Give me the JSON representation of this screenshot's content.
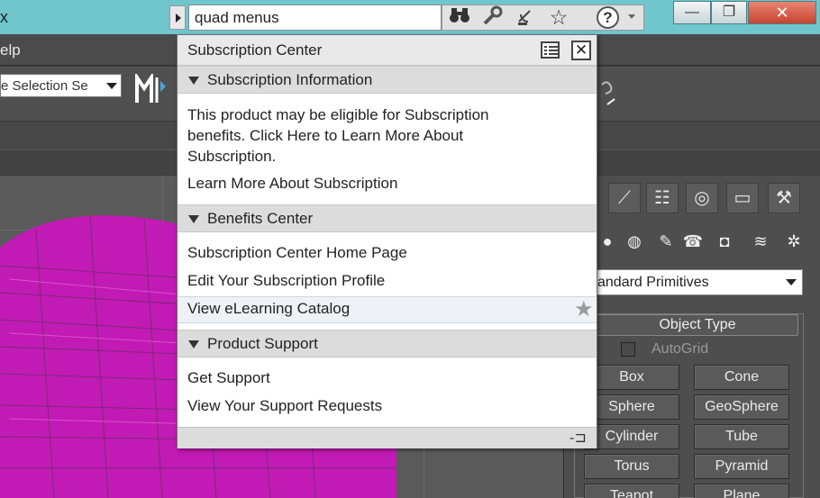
{
  "titlebar": {
    "partial_text": "x",
    "search_value": "quad menus",
    "tool_icons": [
      "binoculars-icon",
      "wrench-icon",
      "satellite-icon",
      "favorites-star-icon"
    ],
    "help_label": "?",
    "minimize": "—",
    "restore": "❐",
    "close": "✕"
  },
  "menubar": {
    "partial_text": "elp"
  },
  "toolbar": {
    "selection_set_value": "e Selection Se"
  },
  "subscription_center": {
    "title": "Subscription Center",
    "sections": [
      {
        "heading": "Subscription Information",
        "items": [
          "This product may be eligible for Subscription",
          "benefits. Click Here to Learn More About",
          "Subscription.",
          "Learn More About Subscription"
        ]
      },
      {
        "heading": "Benefits Center",
        "items": [
          "Subscription Center Home Page",
          "Edit Your Subscription Profile",
          "View eLearning Catalog"
        ]
      },
      {
        "heading": "Product Support",
        "items": [
          "Get Support",
          "View Your Support Requests"
        ]
      }
    ]
  },
  "command_panel": {
    "category_value": "andard Primitives",
    "rollout_title": "Object Type",
    "autogrid_label": "AutoGrid",
    "buttons": [
      "Box",
      "Cone",
      "Sphere",
      "GeoSphere",
      "Cylinder",
      "Tube",
      "Torus",
      "Pyramid",
      "Teapot",
      "Plane"
    ]
  },
  "colors": {
    "titlebar": "#6fc6cd",
    "mesh": "#c21ab4",
    "close_button": "#c7452f"
  }
}
